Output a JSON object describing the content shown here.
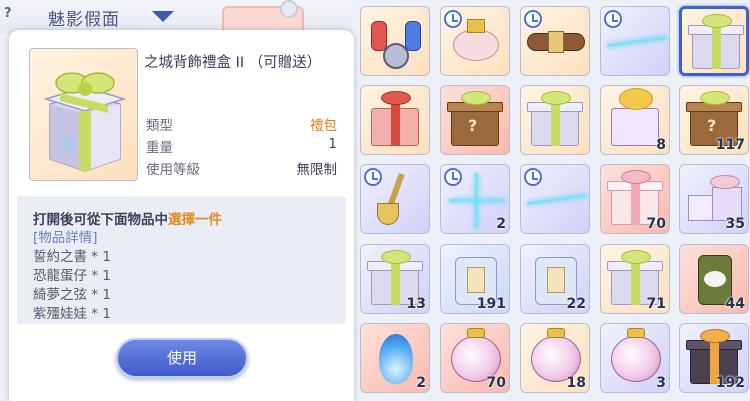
{
  "header": {
    "help_label": "?",
    "title": "魅影假面"
  },
  "tooltip": {
    "item_name": "之城背飾禮盒 II （可贈送）",
    "rows": [
      {
        "label": "類型",
        "value": "禮包"
      },
      {
        "label": "重量",
        "value": "1"
      },
      {
        "label": "使用等級",
        "value": "無限制"
      }
    ],
    "description": {
      "line1_prefix": "打開後可從下面物品中",
      "line1_highlight": "選擇一件",
      "detail_tag": "[物品詳情]",
      "contents": [
        "誓約之書 * 1",
        "恐龍蛋仔 * 1",
        "綺夢之弦 * 1",
        "紫殭娃娃 * 1"
      ]
    },
    "use_button_label": "使用"
  },
  "inventory": {
    "slots": [
      {
        "icon": "potion-set-icon",
        "bg": "orange",
        "timer": false,
        "count": ""
      },
      {
        "icon": "pet-hat-icon",
        "bg": "orange",
        "timer": true,
        "count": ""
      },
      {
        "icon": "belt-icon",
        "bg": "orange",
        "timer": true,
        "count": ""
      },
      {
        "icon": "light-streak-icon",
        "bg": "purple",
        "timer": true,
        "count": ""
      },
      {
        "icon": "gift-box-icon",
        "bg": "orange",
        "timer": false,
        "count": "",
        "selected": true
      },
      {
        "icon": "red-gift-bag-icon",
        "bg": "orange",
        "timer": false,
        "count": ""
      },
      {
        "icon": "mystery-box-icon",
        "bg": "red",
        "timer": false,
        "count": ""
      },
      {
        "icon": "gift-box-icon",
        "bg": "orange",
        "timer": false,
        "count": ""
      },
      {
        "icon": "bell-box-icon",
        "bg": "orange",
        "timer": false,
        "count": "8"
      },
      {
        "icon": "mystery-box-icon",
        "bg": "orange",
        "timer": false,
        "count": "117"
      },
      {
        "icon": "golden-shovel-icon",
        "bg": "purple",
        "timer": true,
        "count": ""
      },
      {
        "icon": "sparkle-cross-icon",
        "bg": "purple",
        "timer": true,
        "count": "2"
      },
      {
        "icon": "light-streak-icon",
        "bg": "purple",
        "timer": true,
        "count": ""
      },
      {
        "icon": "pink-gift-icon",
        "bg": "red",
        "timer": false,
        "count": "70"
      },
      {
        "icon": "gift-pile-icon",
        "bg": "purple",
        "timer": false,
        "count": "35"
      },
      {
        "icon": "gift-box-icon",
        "bg": "purple",
        "timer": false,
        "count": "13"
      },
      {
        "icon": "puzzle-card-icon",
        "bg": "blue",
        "timer": false,
        "count": "191"
      },
      {
        "icon": "puzzle-card-icon",
        "bg": "purple",
        "timer": false,
        "count": "22"
      },
      {
        "icon": "gift-box-icon",
        "bg": "orange",
        "timer": false,
        "count": "71"
      },
      {
        "icon": "canned-food-icon",
        "bg": "red",
        "timer": false,
        "count": "44"
      },
      {
        "icon": "blue-flame-icon",
        "bg": "red",
        "timer": false,
        "count": "2"
      },
      {
        "icon": "pink-orb-icon",
        "bg": "red",
        "timer": false,
        "count": "70"
      },
      {
        "icon": "pink-orb-icon",
        "bg": "orange",
        "timer": false,
        "count": "18"
      },
      {
        "icon": "pink-orb-icon",
        "bg": "purple",
        "timer": false,
        "count": "3"
      },
      {
        "icon": "dark-gift-icon",
        "bg": "purple",
        "timer": false,
        "count": "192"
      }
    ]
  },
  "colors": {
    "accent_blue": "#3b63c9",
    "highlight_orange": "#e38a1e",
    "value_orange": "#e07a18"
  }
}
